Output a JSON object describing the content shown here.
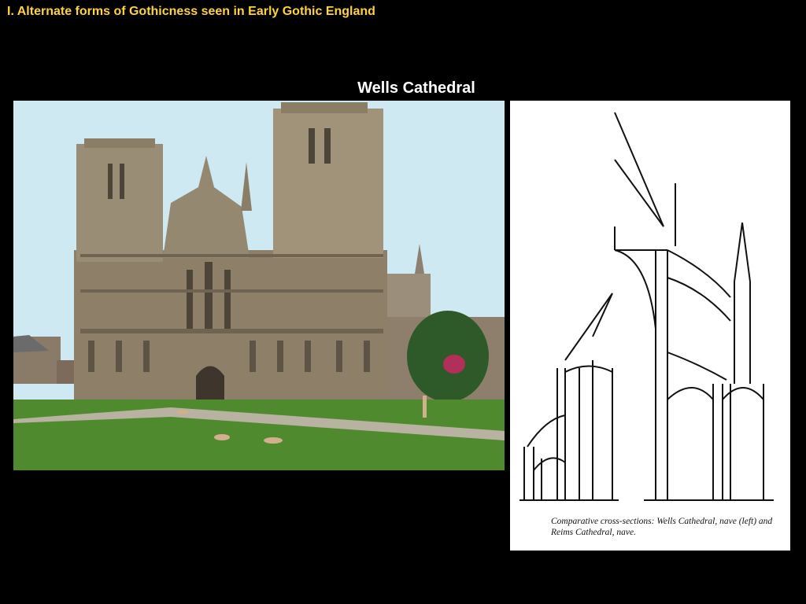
{
  "slide": {
    "title": "I. Alternate forms of Gothicness seen in Early Gothic England",
    "subtitle": "Wells Cathedral"
  },
  "figures": {
    "drawing_caption": "Comparative cross-sections: Wells Cathedral, nave (left) and Reims Cathedral, nave."
  }
}
